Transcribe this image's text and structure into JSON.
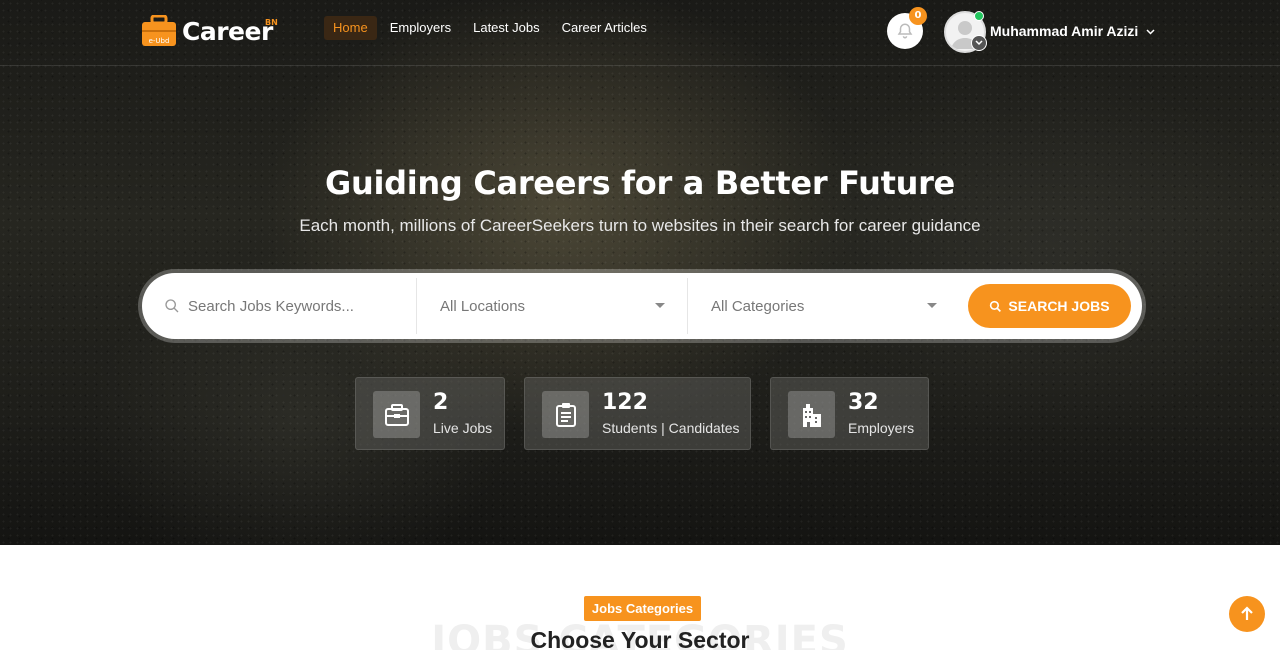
{
  "brand": {
    "name": "Career",
    "sup": "BN",
    "bag_text": "e-Ubd"
  },
  "nav": {
    "items": [
      {
        "label": "Home",
        "active": true
      },
      {
        "label": "Employers",
        "active": false
      },
      {
        "label": "Latest Jobs",
        "active": false
      },
      {
        "label": "Career Articles",
        "active": false
      }
    ]
  },
  "header": {
    "notifications_count": "0",
    "user_name": "Muhammad Amir Azizi"
  },
  "hero": {
    "title": "Guiding Careers for a Better Future",
    "subtitle": "Each month, millions of CareerSeekers turn to websites in their search for career guidance"
  },
  "search": {
    "keyword_placeholder": "Search Jobs Keywords...",
    "location_value": "All Locations",
    "category_value": "All Categories",
    "button_label": "SEARCH JOBS"
  },
  "stats": [
    {
      "icon": "briefcase-icon",
      "value": "2",
      "label": "Live Jobs"
    },
    {
      "icon": "clipboard-icon",
      "value": "122",
      "label": "Students | Candidates"
    },
    {
      "icon": "building-icon",
      "value": "32",
      "label": "Employers"
    }
  ],
  "categories_section": {
    "badge": "Jobs Categories",
    "background_word": "JOBS CATEGORIES",
    "title": "Choose Your Sector"
  },
  "colors": {
    "accent": "#f7931e",
    "online": "#22c55e"
  }
}
